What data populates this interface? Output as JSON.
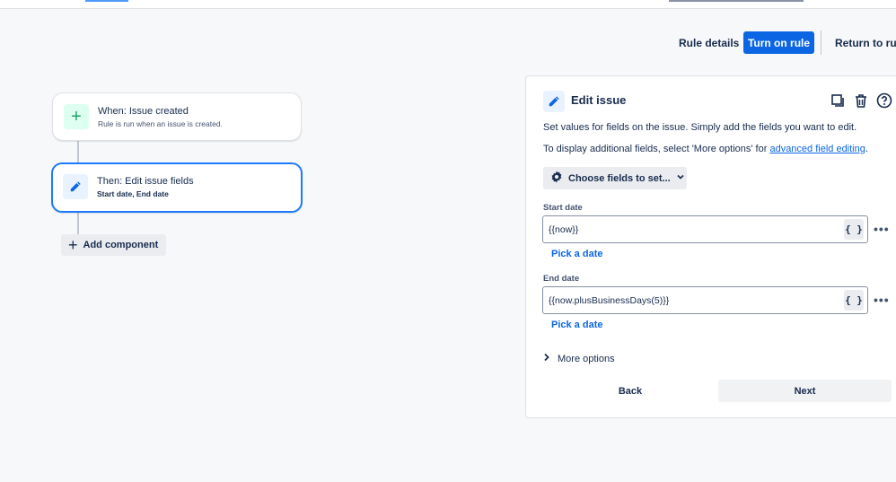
{
  "header": {
    "rule_details": "Rule details",
    "turn_on_rule": "Turn on rule",
    "return_to_rules": "Return to rule"
  },
  "flow": {
    "trigger": {
      "title": "When: Issue created",
      "subtitle": "Rule is run when an issue is created.",
      "icon": "plus-icon"
    },
    "action": {
      "title": "Then: Edit issue fields",
      "subtitle": "Start date, End date",
      "icon": "pencil-icon"
    },
    "add_component": "Add component"
  },
  "panel": {
    "title": "Edit issue",
    "description": "Set values for fields on the issue. Simply add the fields you want to edit.",
    "additional_prefix": "To display additional fields, select 'More options' for ",
    "additional_link": "advanced field editing",
    "additional_suffix": ".",
    "choose_fields": "Choose fields to set...",
    "fields": [
      {
        "label": "Start date",
        "value": "{{now}}",
        "smart": "{ }",
        "pick": "Pick a date"
      },
      {
        "label": "End date",
        "value": "{{now.plusBusinessDays(5)}}",
        "smart": "{ }",
        "pick": "Pick a date"
      }
    ],
    "more_dots": "•••",
    "more_options": "More options",
    "back": "Back",
    "next": "Next"
  },
  "colors": {
    "primary": "#0c66e4",
    "selected_border": "#1d7afc",
    "trigger_green": "#22a06b"
  }
}
